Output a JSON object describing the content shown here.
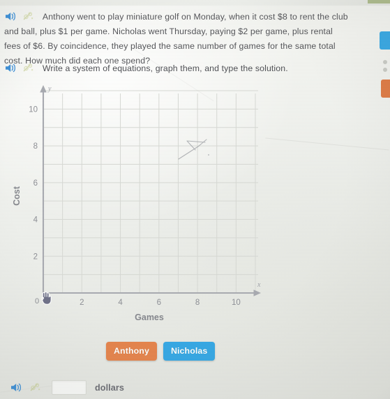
{
  "problem": {
    "speaker_icon": "speaker-icon",
    "hint_icon": "hint-sparkle-icon",
    "text": "Anthony went to play miniature golf on Monday, when it cost $8 to rent the club and ball, plus $1 per game. Nicholas went Thursday, paying $2 per game, plus rental fees of $6. By coincidence, they played the same number of games for the same total cost. How much did each one spend?"
  },
  "instruction": {
    "speaker_icon": "speaker-icon",
    "hint_icon": "hint-sparkle-icon",
    "text": "Write a system of equations, graph them, and type the solution."
  },
  "chart_data": {
    "type": "line",
    "title": "",
    "xlabel": "Games",
    "ylabel": "Cost",
    "x_axis_symbol": "x",
    "y_axis_symbol": "y",
    "origin_label": "0",
    "xlim": [
      0,
      11
    ],
    "ylim": [
      0,
      11
    ],
    "x_ticks": [
      2,
      4,
      6,
      8,
      10
    ],
    "y_ticks": [
      2,
      4,
      6,
      8,
      10
    ],
    "x_tick_labels": [
      "2",
      "4",
      "6",
      "8",
      "10"
    ],
    "y_tick_labels": [
      "2",
      "4",
      "6",
      "8",
      "10"
    ],
    "grid": true,
    "grid_step": 1,
    "series": [],
    "legend": "none",
    "notes": "Empty coordinate plane awaiting user-plotted lines"
  },
  "name_buttons": [
    {
      "label": "Anthony",
      "color": "#e4844c"
    },
    {
      "label": "Nicholas",
      "color": "#36a7e3"
    }
  ],
  "answer": {
    "speaker_icon": "speaker-icon",
    "hint_icon": "hint-sparkle-icon",
    "value": "",
    "placeholder": "",
    "unit_label": "dollars"
  }
}
